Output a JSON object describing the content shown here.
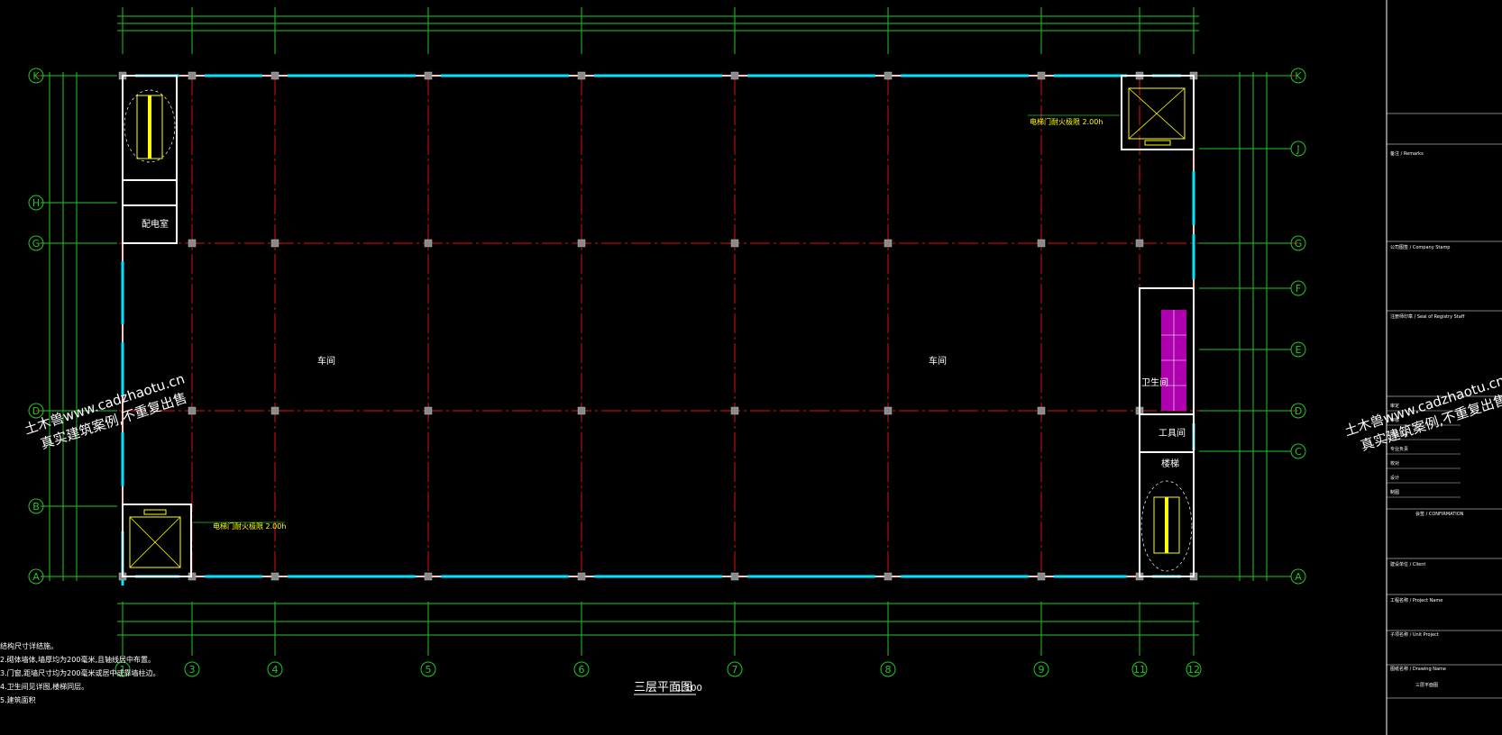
{
  "drawing": {
    "title": "三层平面图",
    "scale": "1:100"
  },
  "grid": {
    "vertical_labels": [
      "1",
      "3",
      "4",
      "5",
      "6",
      "7",
      "8",
      "9",
      "11",
      "12"
    ],
    "horizontal_left_labels": [
      "K",
      "H",
      "G",
      "D",
      "B",
      "A"
    ],
    "horizontal_right_labels": [
      "K",
      "J",
      "G",
      "F",
      "E",
      "D",
      "C",
      "A"
    ]
  },
  "rooms": {
    "workshop_left": "车间",
    "workshop_right": "车间",
    "dist_room": "配电室",
    "toilet": "卫生间",
    "tool_room": "工具间",
    "stair": "楼梯",
    "elevator_note": "电梯门耐火极限 2.00h",
    "elevator_note_right": "电梯门耐火极限 2.00h"
  },
  "notes": {
    "line1": "结构尺寸详结施。",
    "line2": "2.砌体墙体,墙厚均为200毫米,且轴线居中布置。",
    "line3": "3.门窗,距墙尺寸均为200毫米或居中或靠墙柱边。",
    "line4": "4.卫生间见详图,楼梯同层。",
    "line5": "5.建筑面积"
  },
  "watermark": {
    "left_line1": "土木兽www.cadzhaotu.cn",
    "left_line2": "真实建筑案例,不重复出售",
    "right_line1": "土木兽www.cadzhaotu.cn",
    "right_line2": "真实建筑案例,不重复出售"
  },
  "title_block": {
    "remarks": "备注 / Remarks",
    "company_stamp": "公司图签 / Company Stamp",
    "staff": "注册师印章 / Seal of Registry Staff",
    "confirmation": "会签 / CONFIRMATION",
    "client": "建设单位 / Client",
    "project_name": "工程名称 / Project Name",
    "unit_project": "子项名称 / Unit Project",
    "drawing_name_label": "图纸名称 / Drawing Name",
    "drawing_name": "三层平面图",
    "roles": [
      "审定",
      "审核",
      "项目负责",
      "专业负责",
      "校对",
      "设计",
      "制图"
    ]
  }
}
